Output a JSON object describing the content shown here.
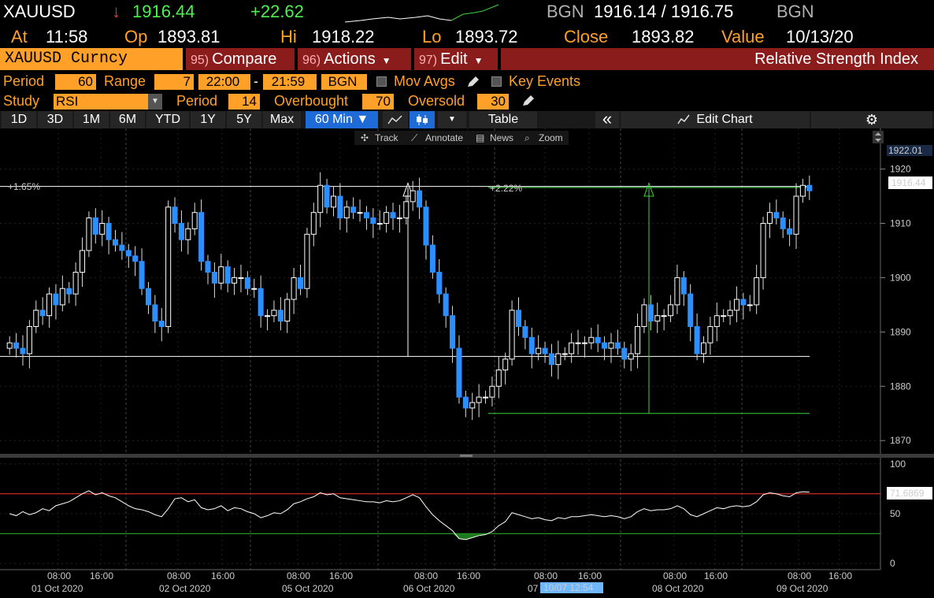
{
  "quote": {
    "ticker": "XAUUSD",
    "arrow": "↓",
    "last": "1916.44",
    "change": "+22.62",
    "bid_src": "BGN",
    "bid_ask": "1916.14 / 1916.75",
    "ask_src": "BGN",
    "at_label": "At",
    "time": "11:58",
    "op_label": "Op",
    "open": "1893.81",
    "hi_label": "Hi",
    "high": "1918.22",
    "lo_label": "Lo",
    "low": "1893.72",
    "close_label": "Close",
    "close": "1893.82",
    "value_label": "Value",
    "value_date": "10/13/20"
  },
  "function_bar": {
    "security": "XAUUSD Curncy",
    "compare_num": "95)",
    "compare": "Compare",
    "actions_num": "96)",
    "actions": "Actions",
    "edit_num": "97)",
    "edit": "Edit",
    "title": "Relative Strength Index"
  },
  "params": {
    "period_label": "Period",
    "period": "60",
    "range_label": "Range",
    "range": "7",
    "from_time": "22:00",
    "dash": "-",
    "to_time": "21:59",
    "source": "BGN",
    "mov_avgs": "Mov Avgs",
    "key_events": "Key Events",
    "study_label": "Study",
    "study": "RSI",
    "rsi_period_label": "Period",
    "rsi_period": "14",
    "overbought_label": "Overbought",
    "overbought": "70",
    "oversold_label": "Oversold",
    "oversold": "30"
  },
  "toolbar": {
    "ranges": [
      "1D",
      "3D",
      "1M",
      "6M",
      "YTD",
      "1Y",
      "5Y",
      "Max"
    ],
    "interval": "60 Min ▼",
    "table": "Table",
    "edit_chart": "Edit Chart",
    "collapse": "«"
  },
  "chart_tools": {
    "track": "Track",
    "annotate": "Annotate",
    "news": "News",
    "zoom": "Zoom"
  },
  "colors": {
    "up": "#ffffff",
    "down": "#2b8fff",
    "accent": "#ffa028",
    "overbought_line": "#ff3030",
    "oversold_line": "#30c030"
  },
  "chart_data": [
    {
      "type": "candlestick",
      "title": "",
      "y_ticks": [
        1870,
        1880,
        1890,
        1900,
        1910,
        1920
      ],
      "ylim": [
        1868,
        1924
      ],
      "last_price": "1916.44",
      "max_label": "1922.01",
      "annotations": [
        {
          "text": "+1.65%",
          "from": 1885.5,
          "to": 1916.8
        },
        {
          "text": "+2.22%",
          "from": 1875.0,
          "to": 1916.8
        }
      ],
      "x_ticks": [
        "08:00",
        "16:00",
        "08:00",
        "16:00",
        "08:00",
        "16:00",
        "08:00",
        "16:00",
        "08:00",
        "16:00",
        "08:00",
        "16:00",
        "08:00",
        "16:00"
      ],
      "x_dates": [
        "01 Oct 2020",
        "02 Oct 2020",
        "05 Oct 2020",
        "06 Oct 2020",
        "07",
        "08 Oct 2020",
        "09 Oct 2020"
      ],
      "cursor_label": "10/07 12:54",
      "closes": [
        1888,
        1887,
        1886,
        1891,
        1894,
        1893,
        1897,
        1895,
        1898,
        1897,
        1901,
        1905,
        1911,
        1908,
        1910,
        1907,
        1906,
        1905,
        1904,
        1903,
        1898,
        1895,
        1892,
        1891,
        1913,
        1910,
        1907,
        1909,
        1912,
        1903,
        1901,
        1899,
        1902,
        1899,
        1900,
        1900,
        1898,
        1898,
        1893,
        1893,
        1894,
        1892,
        1896,
        1900,
        1898,
        1908,
        1912,
        1917,
        1913,
        1915,
        1911,
        1913,
        1912,
        1912,
        1911,
        1910,
        1910,
        1912,
        1911,
        1911,
        1914,
        1916,
        1913,
        1906,
        1901,
        1897,
        1893,
        1887,
        1878,
        1876,
        1877,
        1878,
        1878,
        1880,
        1883,
        1885,
        1894,
        1891,
        1889,
        1886,
        1887,
        1886,
        1884,
        1886,
        1886,
        1888,
        1888,
        1888,
        1889,
        1888,
        1887,
        1888,
        1887,
        1885,
        1886,
        1891,
        1895,
        1892,
        1893,
        1893,
        1895,
        1900,
        1897,
        1891,
        1886,
        1888,
        1891,
        1893,
        1893,
        1894,
        1896,
        1895,
        1895,
        1900,
        1910,
        1912,
        1911,
        1909,
        1908,
        1915,
        1917,
        1916
      ]
    },
    {
      "type": "line",
      "title": "",
      "y_ticks": [
        0,
        50,
        100
      ],
      "ylim": [
        -3,
        103
      ],
      "overbought": 70,
      "oversold": 30,
      "last_value": "71.6869",
      "values": [
        50,
        48,
        52,
        49,
        51,
        55,
        53,
        58,
        60,
        62,
        66,
        70,
        73,
        69,
        71,
        68,
        66,
        62,
        58,
        55,
        54,
        52,
        49,
        47,
        55,
        65,
        66,
        62,
        64,
        56,
        54,
        55,
        58,
        53,
        56,
        55,
        52,
        50,
        46,
        48,
        51,
        50,
        54,
        60,
        62,
        65,
        67,
        71,
        69,
        70,
        66,
        65,
        64,
        63,
        62,
        62,
        61,
        63,
        62,
        63,
        66,
        69,
        66,
        57,
        49,
        43,
        38,
        33,
        25,
        24,
        26,
        28,
        29,
        32,
        38,
        42,
        51,
        49,
        47,
        45,
        46,
        44,
        43,
        46,
        45,
        47,
        47,
        48,
        49,
        48,
        47,
        48,
        47,
        45,
        47,
        52,
        55,
        53,
        54,
        54,
        55,
        58,
        55,
        49,
        47,
        50,
        53,
        56,
        55,
        57,
        58,
        57,
        58,
        62,
        69,
        71,
        70,
        68,
        67,
        71,
        72,
        71.7
      ]
    }
  ]
}
